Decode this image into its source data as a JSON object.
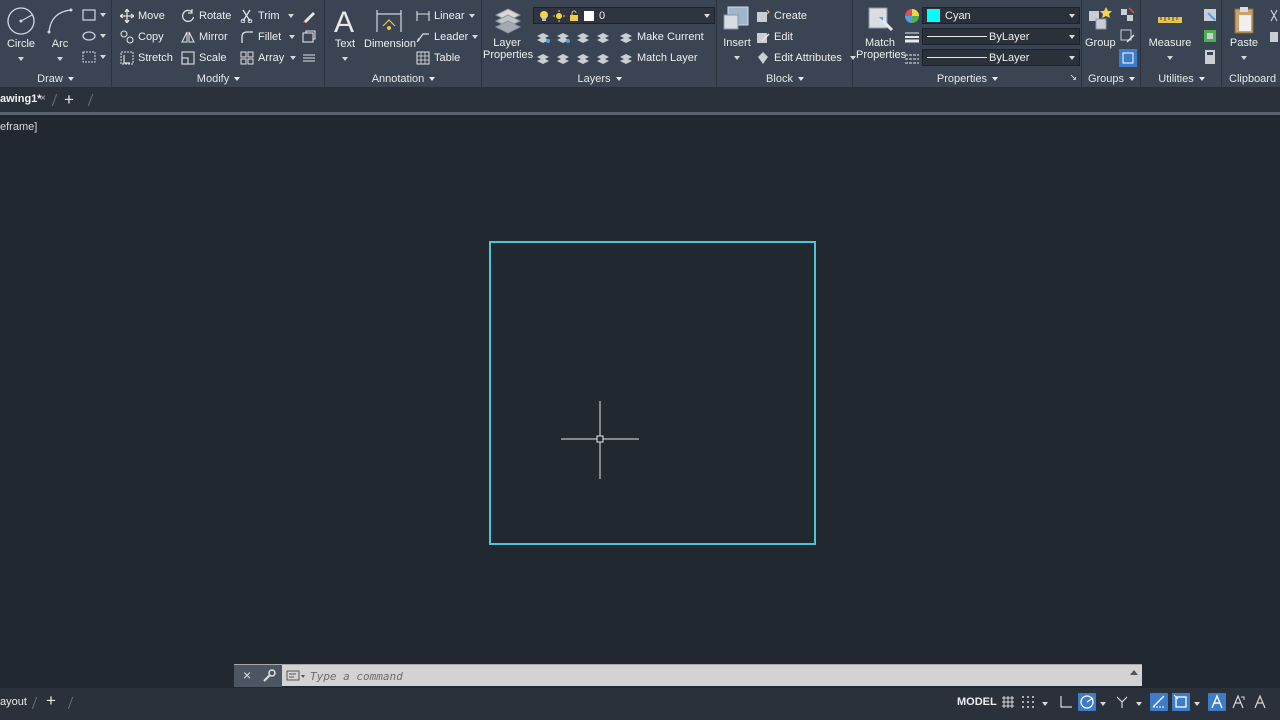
{
  "colors": {
    "ribbon_bg": "#3b4453",
    "canvas_bg": "#212830",
    "accent_blue": "#3d7cc9",
    "rectangle_stroke": "#4ec4d9",
    "cyan_swatch": "#00ffff"
  },
  "ribbon": {
    "draw": {
      "title": "Draw",
      "circle_label": "Circle",
      "arc_label": "Arc",
      "icons": [
        "circle-icon",
        "arc-icon",
        "rectangle-icon",
        "ellipse-icon",
        "hatch-icon"
      ]
    },
    "modify": {
      "title": "Modify",
      "move_label": "Move",
      "rotate_label": "Rotate",
      "trim_label": "Trim",
      "copy_label": "Copy",
      "mirror_label": "Mirror",
      "fillet_label": "Fillet",
      "stretch_label": "Stretch",
      "scale_label": "Scale",
      "array_label": "Array"
    },
    "annotation": {
      "title": "Annotation",
      "text_label": "Text",
      "dimension_label": "Dimension",
      "linear_label": "Linear",
      "leader_label": "Leader",
      "table_label": "Table"
    },
    "layers": {
      "title": "Layers",
      "layer_properties_label_1": "Layer",
      "layer_properties_label_2": "Properties",
      "current_layer": "0",
      "make_current_label": "Make Current",
      "match_layer_label": "Match Layer"
    },
    "block": {
      "title": "Block",
      "insert_label": "Insert",
      "create_label": "Create",
      "edit_label": "Edit",
      "edit_attributes_label": "Edit Attributes"
    },
    "properties": {
      "title": "Properties",
      "match_properties_label_1": "Match",
      "match_properties_label_2": "Properties",
      "color_value": "Cyan",
      "linetype_value": "ByLayer",
      "lineweight_value": "ByLayer"
    },
    "groups": {
      "title": "Groups",
      "group_label": "Group"
    },
    "utilities": {
      "title": "Utilities",
      "measure_label": "Measure"
    },
    "clipboard": {
      "title": "Clipboard",
      "paste_label": "Paste"
    }
  },
  "tabs": {
    "document_tab": "awing1*",
    "close_glyph": "×"
  },
  "canvas": {
    "viewport_label": "eframe]"
  },
  "command_line": {
    "placeholder": "Type a command"
  },
  "status_bar": {
    "layout_tab": "ayout",
    "model_label": "MODEL"
  }
}
